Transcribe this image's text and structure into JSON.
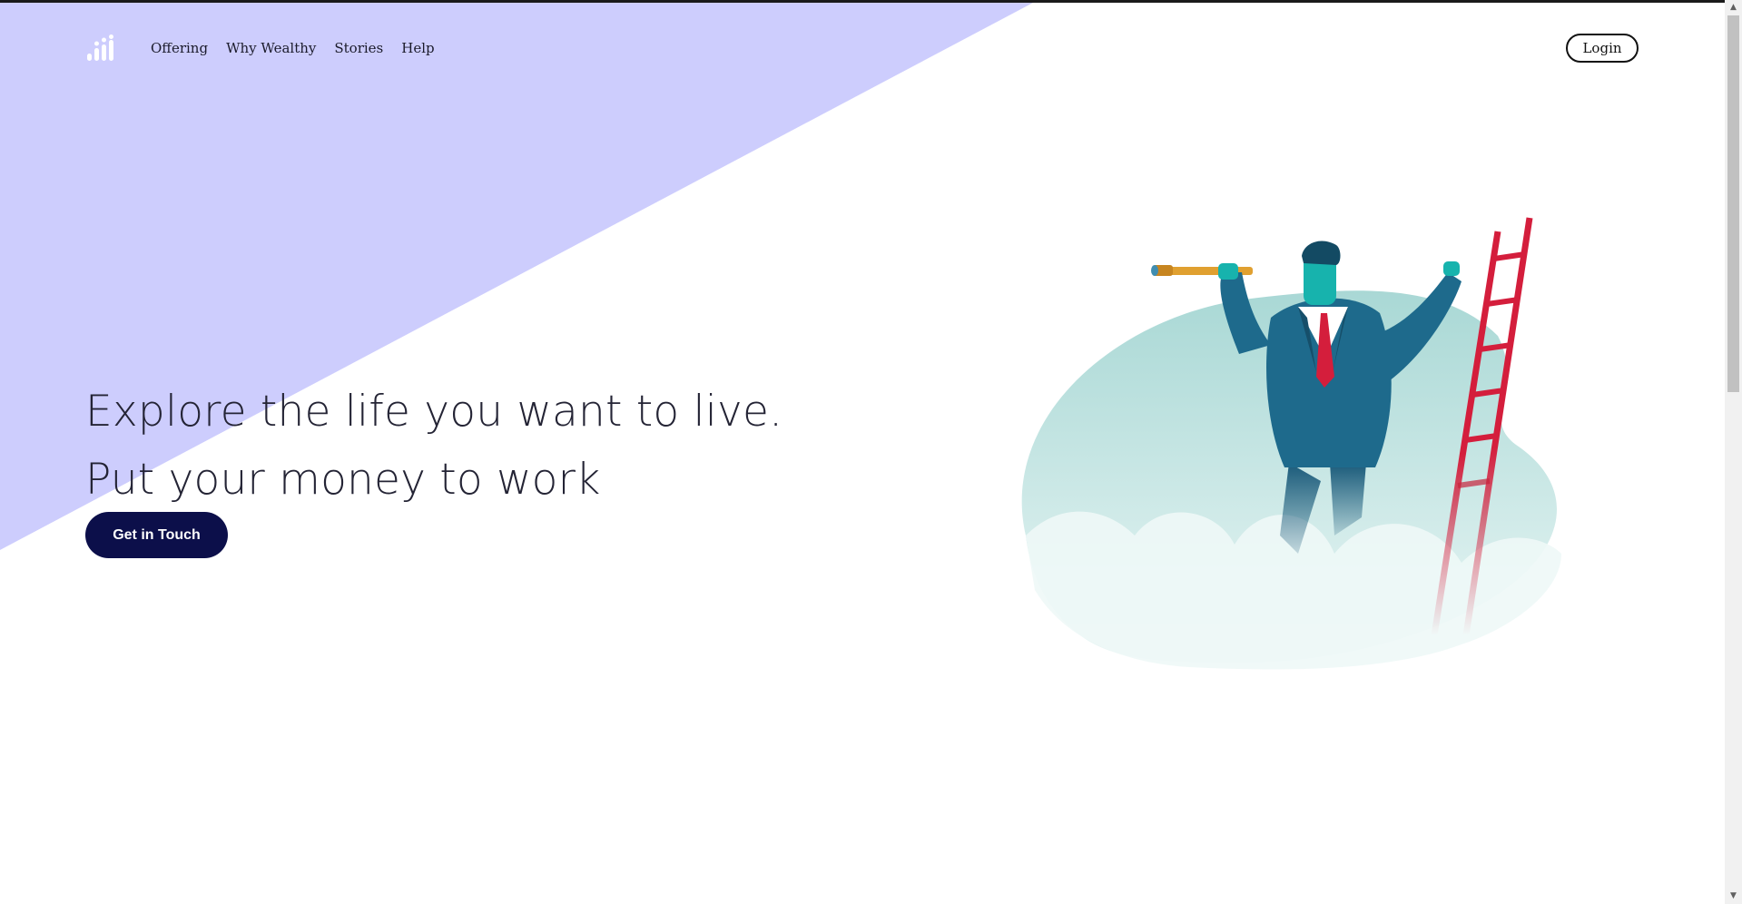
{
  "nav": {
    "logo_icon": "bar-chart-dots-logo-icon",
    "links": [
      "Offering",
      "Why Wealthy",
      "Stories",
      "Help"
    ],
    "login_label": "Login"
  },
  "hero": {
    "line1": "Explore the life you want to live.",
    "line2": "Put your money to work",
    "cta_label": "Get in Touch",
    "illustration_icon": "businessman-telescope-ladder-illustration"
  },
  "colors": {
    "accent_background": "#cdcdfd",
    "cta_background": "#0c0f4a",
    "text": "#242435"
  }
}
